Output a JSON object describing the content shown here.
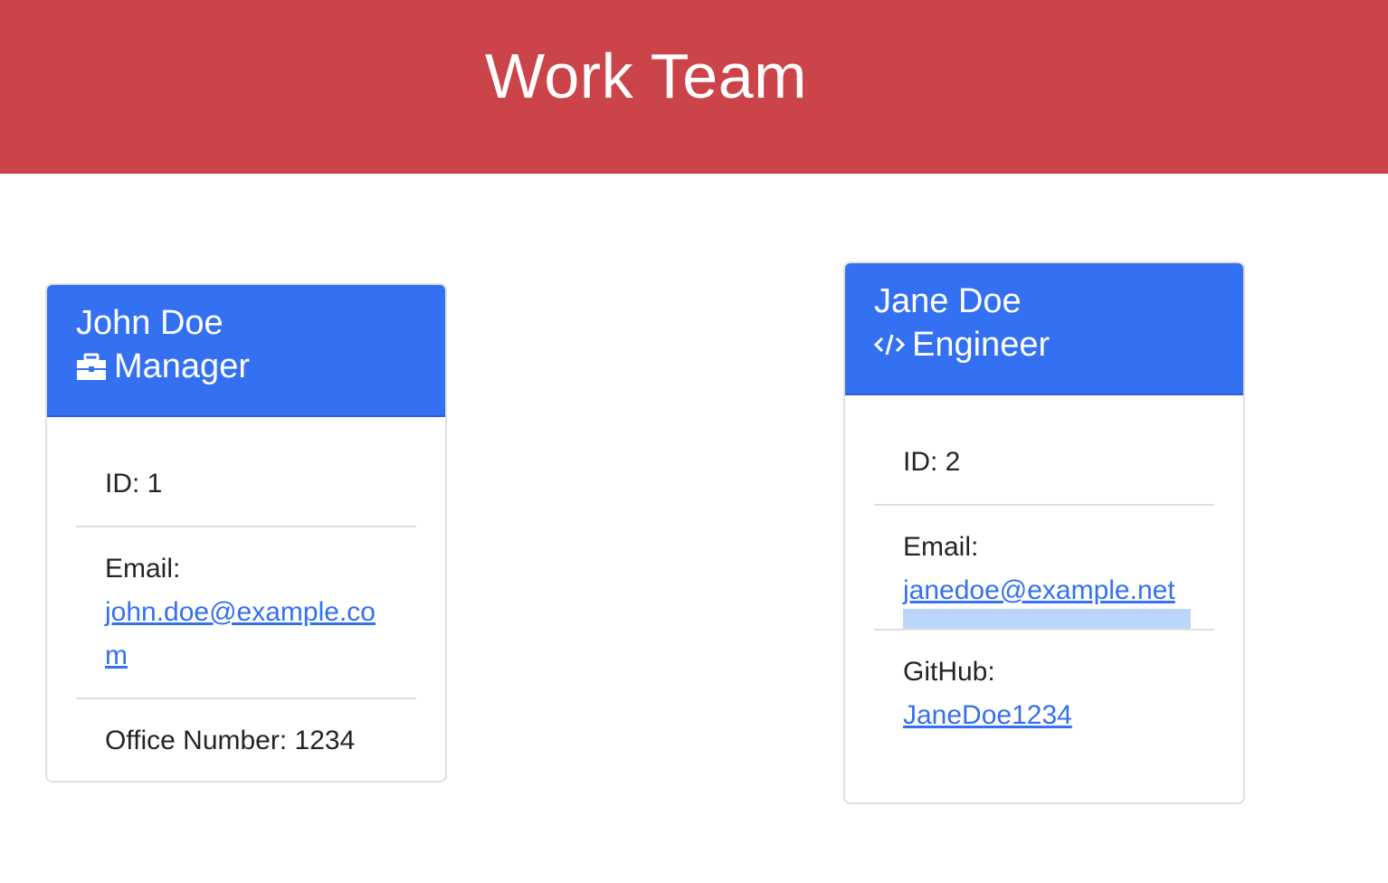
{
  "header": {
    "title": "Work Team"
  },
  "colors": {
    "header_bg": "#cb444a",
    "card_header_bg": "#3470f2",
    "link": "#3470f2"
  },
  "employees": [
    {
      "name": "John Doe",
      "role": "Manager",
      "role_icon": "briefcase-icon",
      "id_text": "ID: 1",
      "email_label": "Email:",
      "email": "john.doe@example.com",
      "extra_label": "Office Number: 1234"
    },
    {
      "name": "Jane Doe",
      "role": "Engineer",
      "role_icon": "code-icon",
      "id_text": "ID: 2",
      "email_label": "Email:",
      "email": "janedoe@example.net",
      "github_label": "GitHub:",
      "github": "JaneDoe1234"
    }
  ]
}
